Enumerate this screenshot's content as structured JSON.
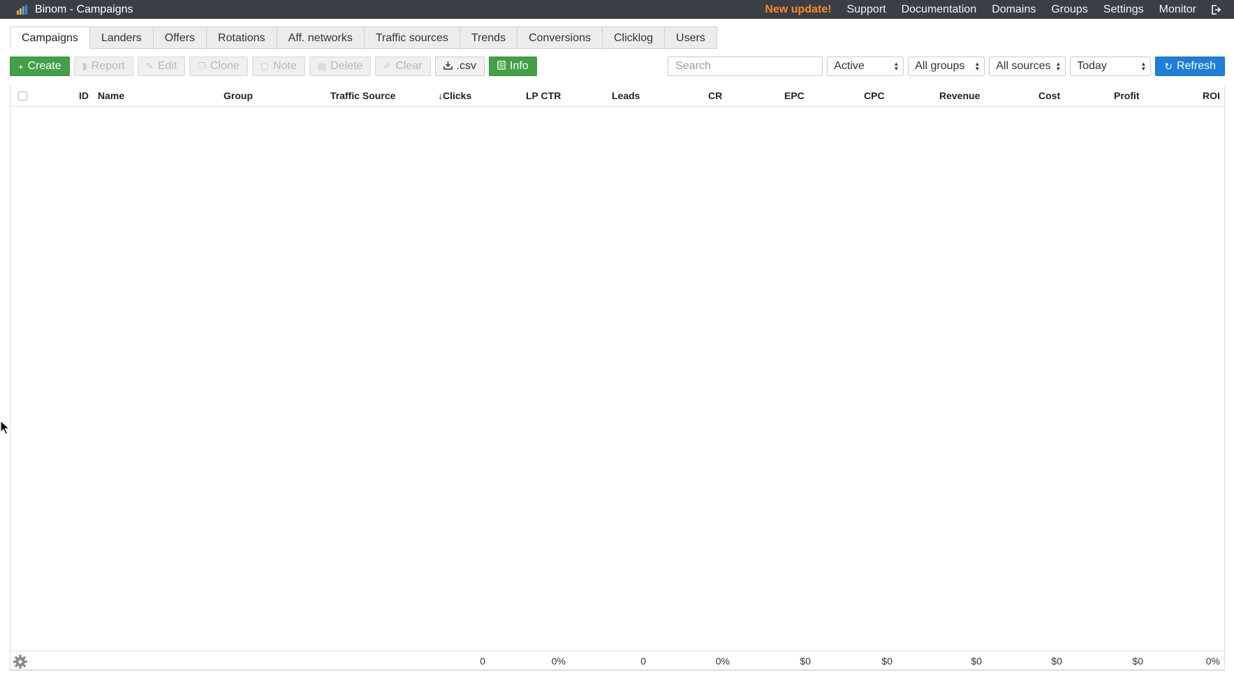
{
  "window": {
    "title": "Binom - Campaigns"
  },
  "topnav": {
    "update": "New update!",
    "items": [
      "Support",
      "Documentation",
      "Domains",
      "Groups",
      "Settings",
      "Monitor"
    ],
    "update_color": "#ff8a1e"
  },
  "tabs": [
    {
      "label": "Campaigns",
      "active": true
    },
    {
      "label": "Landers"
    },
    {
      "label": "Offers"
    },
    {
      "label": "Rotations"
    },
    {
      "label": "Aff. networks"
    },
    {
      "label": "Traffic sources"
    },
    {
      "label": "Trends"
    },
    {
      "label": "Conversions"
    },
    {
      "label": "Clicklog"
    },
    {
      "label": "Users"
    }
  ],
  "toolbar": {
    "create": "Create",
    "report": "Report",
    "edit": "Edit",
    "clone": "Clone",
    "note": "Note",
    "delete": "Delete",
    "clear": "Clear",
    "csv": ".csv",
    "info": "Info"
  },
  "filters": {
    "search_placeholder": "Search",
    "status": "Active",
    "groups": "All groups",
    "sources": "All sources",
    "period": "Today",
    "refresh": "Refresh"
  },
  "table": {
    "columns": [
      "ID",
      "Name",
      "Group",
      "Traffic Source",
      "Clicks",
      "LP CTR",
      "Leads",
      "CR",
      "EPC",
      "CPC",
      "Revenue",
      "Cost",
      "Profit",
      "ROI"
    ],
    "sorted_column": "Clicks",
    "rows": [],
    "totals": {
      "clicks": "0",
      "lp_ctr": "0%",
      "leads": "0",
      "cr": "0%",
      "epc": "$0",
      "cpc": "$0",
      "revenue": "$0",
      "cost": "$0",
      "profit": "$0",
      "roi": "0%"
    }
  },
  "colors": {
    "topbar": "#3a3f47",
    "create_button": "#43a047",
    "refresh_button": "#1e7ed8"
  }
}
